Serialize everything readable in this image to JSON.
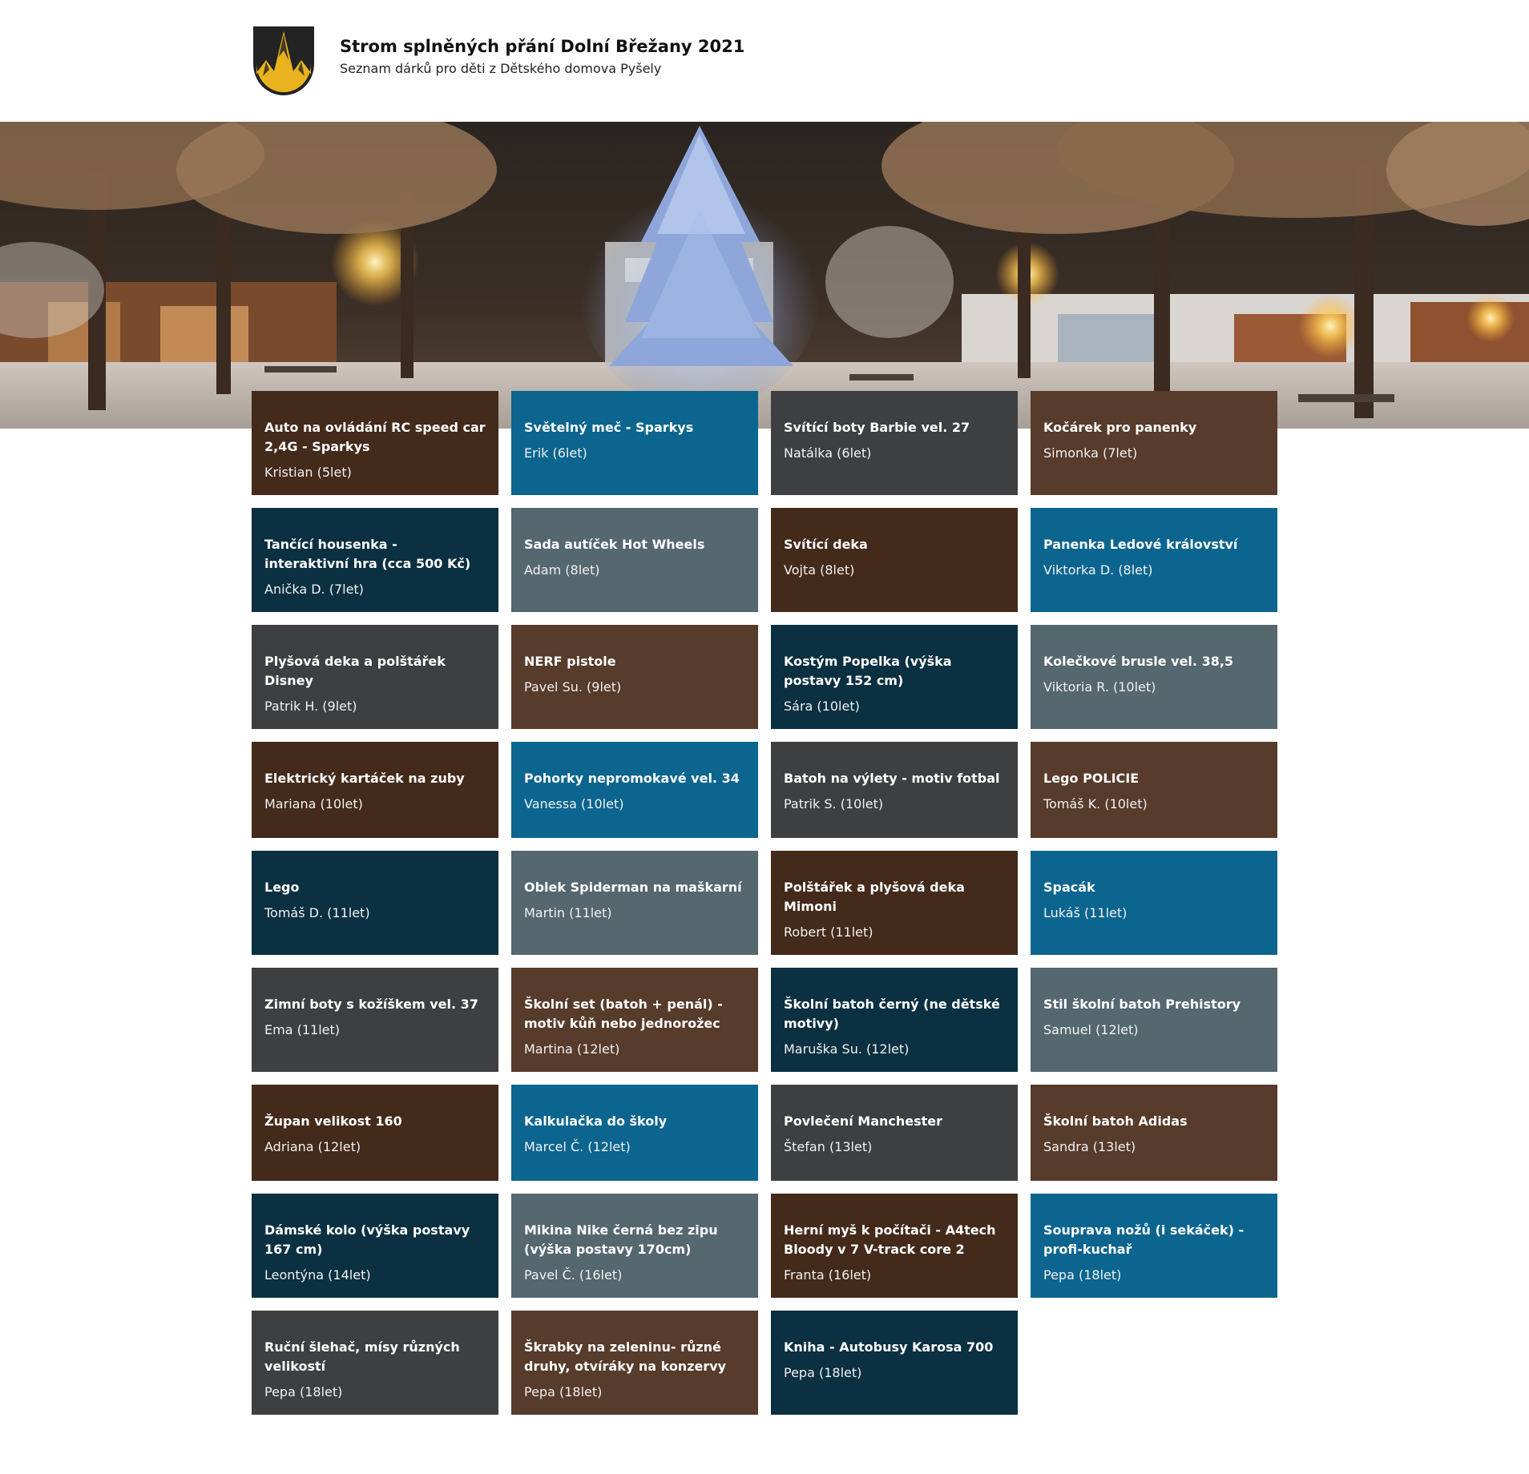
{
  "header": {
    "logo_icon": "mountain-shield-logo",
    "title": "Strom splněných přání Dolní Břežany 2021",
    "subtitle": "Seznam dárků pro děti z Dětského domova Pyšely"
  },
  "hero": {
    "image": "night-square-christmas-tree-photo"
  },
  "colors": {
    "dark_brown": "#432a1a",
    "blue": "#0b658f",
    "charcoal": "#3d3f41",
    "brown": "#573b2b",
    "navy": "#0b3041",
    "slate": "#55676f"
  },
  "wishes": [
    {
      "title": "Auto na ovládání RC speed car 2,4G - Sparkys",
      "name": "Kristian (5let)"
    },
    {
      "title": "Světelný meč - Sparkys",
      "name": "Erik (6let)"
    },
    {
      "title": "Svítící boty Barbie vel. 27",
      "name": "Natálka (6let)"
    },
    {
      "title": "Kočárek pro panenky",
      "name": "Simonka (7let)"
    },
    {
      "title": "Tančící housenka - interaktivní hra (cca 500 Kč)",
      "name": "Anička D. (7let)"
    },
    {
      "title": "Sada autíček Hot Wheels",
      "name": "Adam (8let)"
    },
    {
      "title": "Svítící deka",
      "name": "Vojta (8let)"
    },
    {
      "title": "Panenka Ledové království",
      "name": "Viktorka D. (8let)"
    },
    {
      "title": "Plyšová deka a polštářek Disney",
      "name": "Patrik H. (9let)"
    },
    {
      "title": "NERF pistole",
      "name": "Pavel Su. (9let)"
    },
    {
      "title": "Kostým Popelka (výška postavy 152 cm)",
      "name": "Sára (10let)"
    },
    {
      "title": "Kolečkové brusle vel. 38,5",
      "name": "Viktoria R. (10let)"
    },
    {
      "title": "Elektrický kartáček na zuby",
      "name": "Mariana (10let)"
    },
    {
      "title": "Pohorky nepromokavé vel. 34",
      "name": "Vanessa (10let)"
    },
    {
      "title": "Batoh na výlety - motiv fotbal",
      "name": "Patrik S. (10let)"
    },
    {
      "title": "Lego POLICIE",
      "name": "Tomáš K. (10let)"
    },
    {
      "title": "Lego",
      "name": "Tomáš D. (11let)"
    },
    {
      "title": "Oblek Spiderman na maškarní",
      "name": "Martin (11let)"
    },
    {
      "title": "Polštářek a plyšová deka Mimoni",
      "name": "Robert (11let)"
    },
    {
      "title": "Spacák",
      "name": "Lukáš (11let)"
    },
    {
      "title": "Zimní boty s kožíškem vel. 37",
      "name": "Ema (11let)"
    },
    {
      "title": "Školní set (batoh + penál) - motiv kůň nebo jednorožec",
      "name": "Martina (12let)"
    },
    {
      "title": "Školní batoh černý (ne dětské motivy)",
      "name": "Maruška Su. (12let)"
    },
    {
      "title": "Stil školní batoh Prehistory",
      "name": "Samuel (12let)"
    },
    {
      "title": "Župan velikost 160",
      "name": "Adriana (12let)"
    },
    {
      "title": "Kalkulačka do školy",
      "name": "Marcel Č. (12let)"
    },
    {
      "title": "Povlečení Manchester",
      "name": "Štefan (13let)"
    },
    {
      "title": "Školní batoh Adidas",
      "name": "Sandra (13let)"
    },
    {
      "title": "Dámské kolo (výška postavy 167 cm)",
      "name": "Leontýna (14let)"
    },
    {
      "title": "Mikina Nike černá bez zipu (výška postavy 170cm)",
      "name": "Pavel Č. (16let)"
    },
    {
      "title": "Herní myš k počítači - A4tech Bloody v 7 V-track core 2",
      "name": "Franta (16let)"
    },
    {
      "title": "Souprava nožů (i sekáček) - profi-kuchař",
      "name": "Pepa (18let)"
    },
    {
      "title": "Ruční šlehač, mísy různých velikostí",
      "name": "Pepa (18let)"
    },
    {
      "title": "Škrabky na zeleninu- různé druhy, otvíráky na konzervy",
      "name": "Pepa (18let)"
    },
    {
      "title": "Kniha - Autobusy Karosa 700",
      "name": "Pepa (18let)"
    }
  ]
}
